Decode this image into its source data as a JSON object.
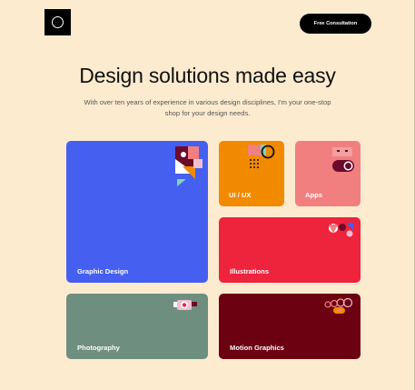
{
  "header": {
    "logo": "logo-ring-icon",
    "cta_label": "Free Consultation"
  },
  "hero": {
    "headline": "Design solutions made easy",
    "subtitle": "With over ten years of experience in various design disciplines, I'm your one-stop shop for your design needs."
  },
  "services": [
    {
      "label": "Graphic Design",
      "color": "#4560F0",
      "icon": "graphic-design-art-icon"
    },
    {
      "label": "UI / UX",
      "color": "#F28A00",
      "icon": "ui-ux-art-icon"
    },
    {
      "label": "Apps",
      "color": "#F27F7F",
      "icon": "apps-art-icon"
    },
    {
      "label": "Illustrations",
      "color": "#EE233C",
      "icon": "illustrations-art-icon"
    },
    {
      "label": "Photography",
      "color": "#6E8E7F",
      "icon": "camera-art-icon"
    },
    {
      "label": "Motion Graphics",
      "color": "#6B0111",
      "icon": "motion-graphics-art-icon"
    }
  ],
  "colors": {
    "background": "#FDEBCF",
    "text": "#111111",
    "button": "#000000"
  }
}
